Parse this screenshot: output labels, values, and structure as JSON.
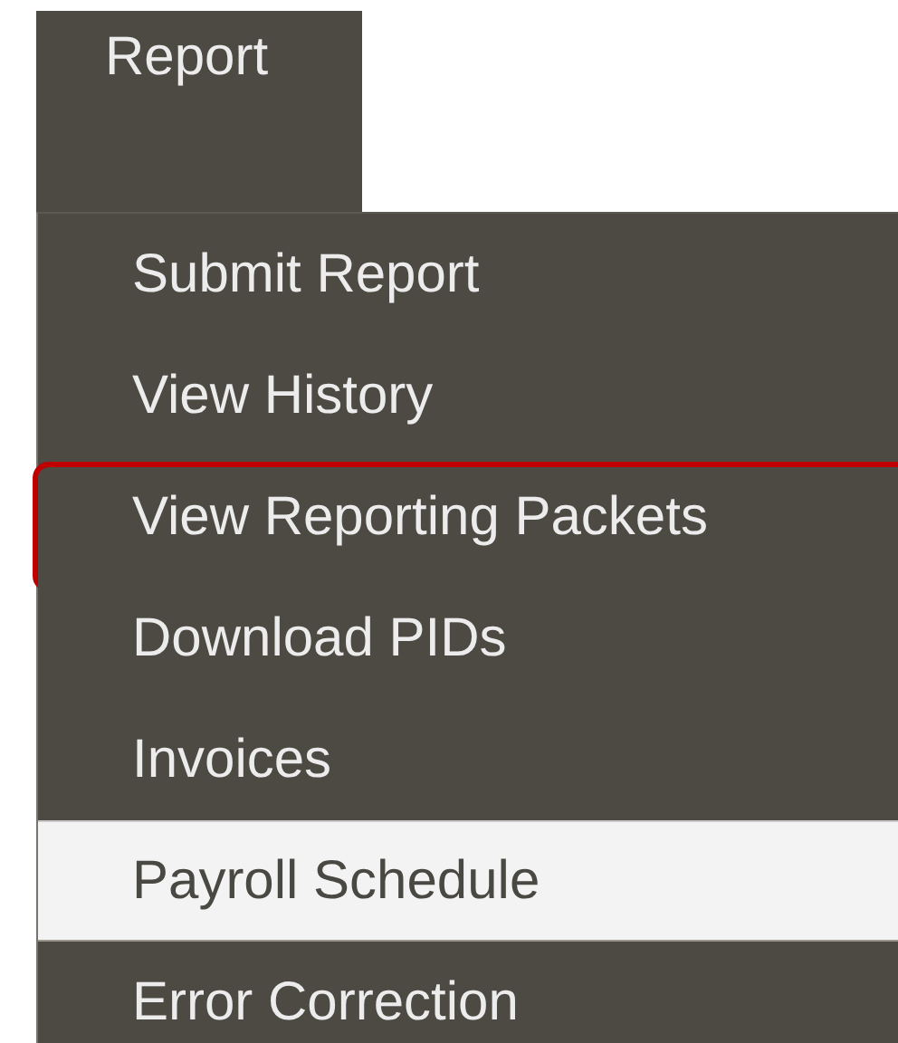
{
  "menu": {
    "title": "Report",
    "items": [
      {
        "label": "Submit Report",
        "selected": false,
        "outlined": false
      },
      {
        "label": "View History",
        "selected": false,
        "outlined": false
      },
      {
        "label": "View Reporting Packets",
        "selected": false,
        "outlined": true
      },
      {
        "label": "Download PIDs",
        "selected": false,
        "outlined": false
      },
      {
        "label": "Invoices",
        "selected": false,
        "outlined": false
      },
      {
        "label": "Payroll Schedule",
        "selected": true,
        "outlined": false
      },
      {
        "label": "Error Correction",
        "selected": false,
        "outlined": false
      }
    ]
  }
}
